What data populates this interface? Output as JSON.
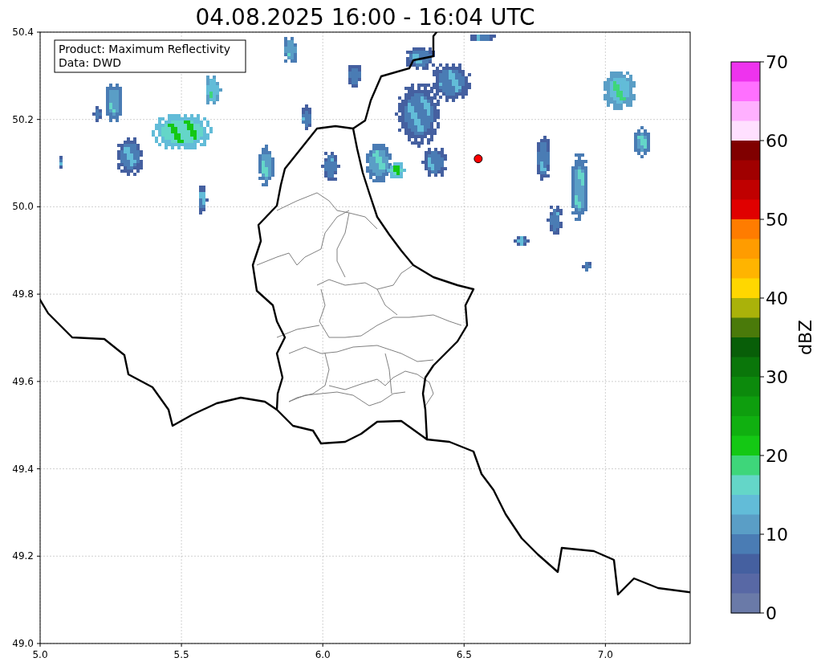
{
  "chart_data": {
    "type": "scatter",
    "title": "04.08.2025 16:00 - 16:04 UTC",
    "x": [
      6.55
    ],
    "series": [
      {
        "color": "#ff0000",
        "values": [
          50.11
        ]
      }
    ],
    "xlim": [
      5.0,
      7.3
    ],
    "ylim": [
      49.0,
      50.4
    ],
    "grid": true,
    "xticks": [
      {
        "value": 5,
        "label": "5.0"
      },
      {
        "value": 5.5,
        "label": "5.5"
      },
      {
        "value": 6,
        "label": "6.0"
      },
      {
        "value": 6.5,
        "label": "6.5"
      },
      {
        "value": 7,
        "label": "7.0"
      }
    ],
    "yticks": [
      {
        "value": 50.4,
        "label": "50.4"
      },
      {
        "value": 50.2,
        "label": "50.2"
      },
      {
        "value": 50,
        "label": "50.0"
      },
      {
        "value": 49.8,
        "label": "49.8"
      },
      {
        "value": 49.6,
        "label": "49.6"
      },
      {
        "value": 49.4,
        "label": "49.4"
      },
      {
        "value": 49.2,
        "label": "49.2"
      },
      {
        "value": 49,
        "label": "49.0"
      }
    ]
  },
  "annotation": {
    "lines": [
      "Product: Maximum Reflectivity",
      "Data: DWD"
    ]
  },
  "colorbar": {
    "label": "dBZ",
    "ticks": [
      "70",
      "60",
      "50",
      "40",
      "30",
      "20",
      "10",
      "0"
    ],
    "bands": [
      {
        "color": "#ee33ee"
      },
      {
        "color": "#ff70ff"
      },
      {
        "color": "#ffb0ff"
      },
      {
        "color": "#ffe0ff"
      },
      {
        "color": "#800000"
      },
      {
        "color": "#a00000"
      },
      {
        "color": "#c00000"
      },
      {
        "color": "#e00000"
      },
      {
        "color": "#ff7c00"
      },
      {
        "color": "#ff9c00"
      },
      {
        "color": "#ffb400"
      },
      {
        "color": "#ffd700"
      },
      {
        "color": "#aab20a"
      },
      {
        "color": "#4a7a0a"
      },
      {
        "color": "#085e08"
      },
      {
        "color": "#0a760a"
      },
      {
        "color": "#0c8a0c"
      },
      {
        "color": "#0e9e0e"
      },
      {
        "color": "#10b010"
      },
      {
        "color": "#14c814"
      },
      {
        "color": "#3ed67a"
      },
      {
        "color": "#64d6c8"
      },
      {
        "color": "#62bcd8"
      },
      {
        "color": "#5a9ec6"
      },
      {
        "color": "#4a7cb4"
      },
      {
        "color": "#4560a0"
      },
      {
        "color": "#5868a5"
      },
      {
        "color": "#6a7aa8"
      }
    ]
  }
}
